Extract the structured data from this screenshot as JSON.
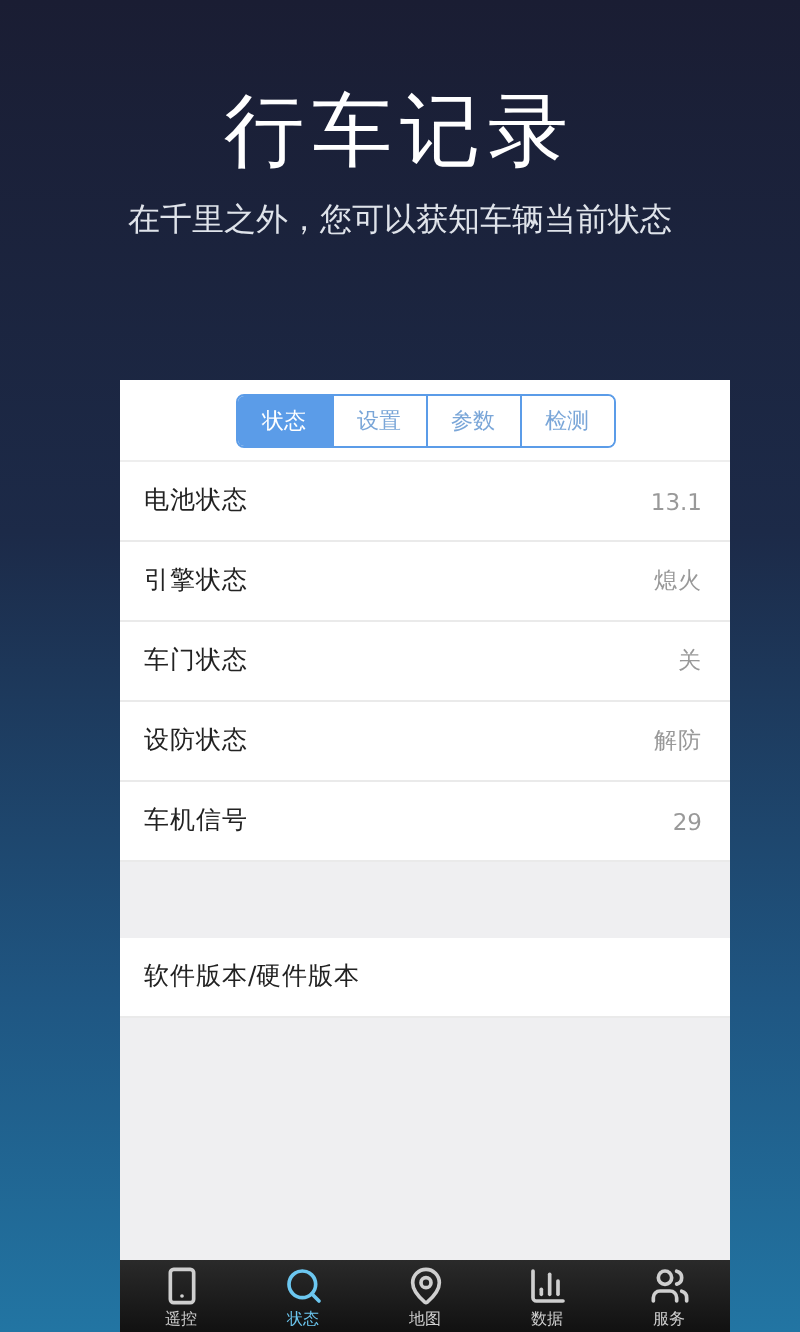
{
  "headline": {
    "title": "行车记录",
    "subtitle": "在千里之外，您可以获知车辆当前状态"
  },
  "segments": [
    {
      "label": "状态",
      "selected": true
    },
    {
      "label": "设置",
      "selected": false
    },
    {
      "label": "参数",
      "selected": false
    },
    {
      "label": "检测",
      "selected": false
    }
  ],
  "status_rows": [
    {
      "label": "电池状态",
      "value": "13.1"
    },
    {
      "label": "引擎状态",
      "value": "熄火"
    },
    {
      "label": "车门状态",
      "value": "关"
    },
    {
      "label": "设防状态",
      "value": "解防"
    },
    {
      "label": "车机信号",
      "value": "29"
    }
  ],
  "version_row": {
    "label": "软件版本/硬件版本"
  },
  "bottom_nav": [
    {
      "label": "遥控",
      "selected": false
    },
    {
      "label": "状态",
      "selected": true
    },
    {
      "label": "地图",
      "selected": false
    },
    {
      "label": "数据",
      "selected": false
    },
    {
      "label": "服务",
      "selected": false
    }
  ]
}
